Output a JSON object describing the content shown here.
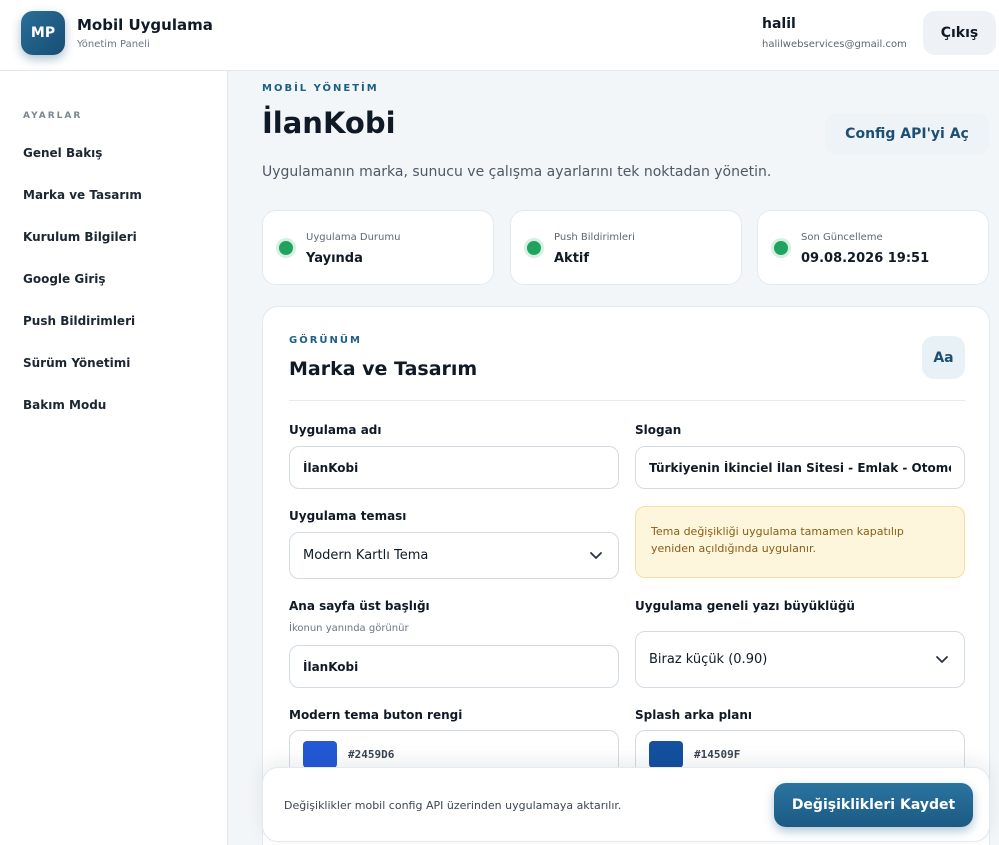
{
  "header": {
    "logo_text": "MP",
    "app_title": "Mobil Uygulama",
    "app_subtitle": "Yönetim Paneli",
    "user_name": "halil",
    "user_email": "halilwebservices@gmail.com",
    "logout_label": "Çıkış"
  },
  "sidebar": {
    "section_label": "AYARLAR",
    "items": [
      {
        "label": "Genel Bakış"
      },
      {
        "label": "Marka ve Tasarım"
      },
      {
        "label": "Kurulum Bilgileri"
      },
      {
        "label": "Google Giriş"
      },
      {
        "label": "Push Bildirimleri"
      },
      {
        "label": "Sürüm Yönetimi"
      },
      {
        "label": "Bakım Modu"
      }
    ]
  },
  "page": {
    "eyebrow": "MOBİL YÖNETİM",
    "title": "İlanKobi",
    "config_button": "Config API'yi Aç",
    "description": "Uygulamanın marka, sunucu ve çalışma ayarlarını tek noktadan yönetin."
  },
  "stats": [
    {
      "label": "Uygulama Durumu",
      "value": "Yayında"
    },
    {
      "label": "Push Bildirimleri",
      "value": "Aktif"
    },
    {
      "label": "Son Güncelleme",
      "value": "09.08.2026 19:51"
    }
  ],
  "card": {
    "eyebrow": "GÖRÜNÜM",
    "title": "Marka ve Tasarım",
    "badge": "Aa"
  },
  "form": {
    "app_name_label": "Uygulama adı",
    "app_name_value": "İlanKobi",
    "slogan_label": "Slogan",
    "slogan_value": "Türkiyenin İkinciel İlan Sitesi - Emlak - Otomobil Alım Satım",
    "theme_label": "Uygulama teması",
    "theme_value": "Modern Kartlı Tema",
    "theme_notice": "Tema değişikliği uygulama tamamen kapatılıp yeniden açıldığında uygulanır.",
    "header_title_label": "Ana sayfa üst başlığı",
    "header_title_hint": "İkonun yanında görünür",
    "header_title_value": "İlanKobi",
    "font_size_label": "Uygulama geneli yazı büyüklüğü",
    "font_size_value": "Biraz küçük (0.90)",
    "button_color_label": "Modern tema buton rengi",
    "button_color_value": "#2459D6",
    "splash_bg_label": "Splash arka planı",
    "splash_bg_value": "#14509F"
  },
  "savebar": {
    "note": "Değişiklikler mobil config API üzerinden uygulamaya aktarılır.",
    "save_label": "Değişiklikleri Kaydet"
  },
  "colors": {
    "accent": "#1c5f85",
    "status_ok": "#1fa35f",
    "notice_bg": "#fdf6dc"
  }
}
